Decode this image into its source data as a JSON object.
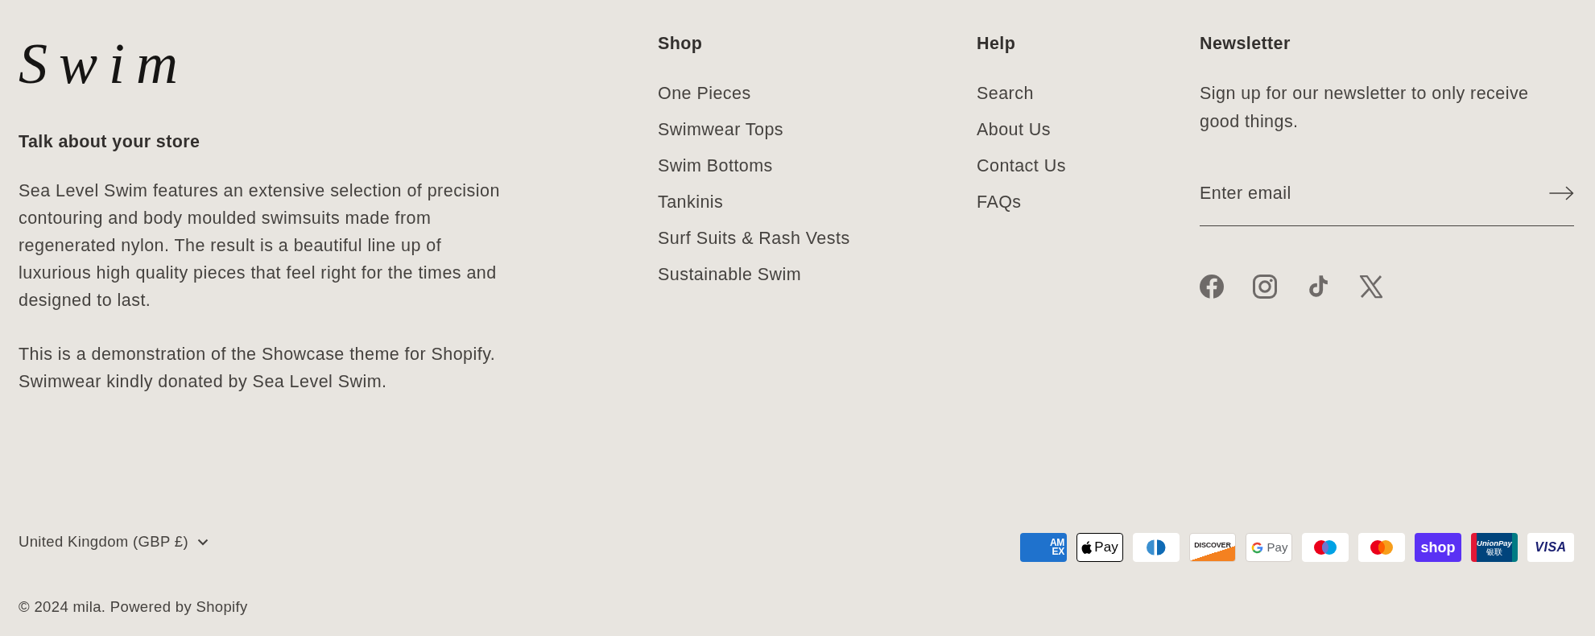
{
  "logo": {
    "text": "Swim"
  },
  "about": {
    "heading": "Talk about your store",
    "paragraphs": [
      "Sea Level Swim features an extensive selection of precision contouring and body moulded swimsuits made from regenerated nylon. The result is a beautiful line up of luxurious high quality pieces that feel right for the times and designed to last.",
      "This is a demonstration of the Showcase theme for Shopify. Swimwear kindly donated by Sea Level Swim."
    ]
  },
  "menus": [
    {
      "heading": "Shop",
      "links": [
        "One Pieces",
        "Swimwear Tops",
        "Swim Bottoms",
        "Tankinis",
        "Surf Suits & Rash Vests",
        "Sustainable Swim"
      ]
    },
    {
      "heading": "Help",
      "links": [
        "Search",
        "About Us",
        "Contact Us",
        "FAQs"
      ]
    }
  ],
  "newsletter": {
    "heading": "Newsletter",
    "text": "Sign up for our newsletter to only receive good things.",
    "email": {
      "placeholder": "Enter email"
    }
  },
  "country_selector": {
    "label": "United Kingdom (GBP £)"
  },
  "payment_methods": [
    {
      "kind": "amex",
      "label": "AM EX"
    },
    {
      "kind": "apple_pay",
      "label": "Pay"
    },
    {
      "kind": "diners"
    },
    {
      "kind": "discover",
      "label": "DISCOVER"
    },
    {
      "kind": "google_pay",
      "label": "Pay"
    },
    {
      "kind": "maestro"
    },
    {
      "kind": "mastercard"
    },
    {
      "kind": "shop_pay",
      "label": "shop"
    },
    {
      "kind": "unionpay",
      "label": "UnionPay",
      "sublabel": "银联"
    },
    {
      "kind": "visa",
      "label": "VISA"
    }
  ],
  "copyright": "© 2024 mila. Powered by Shopify"
}
